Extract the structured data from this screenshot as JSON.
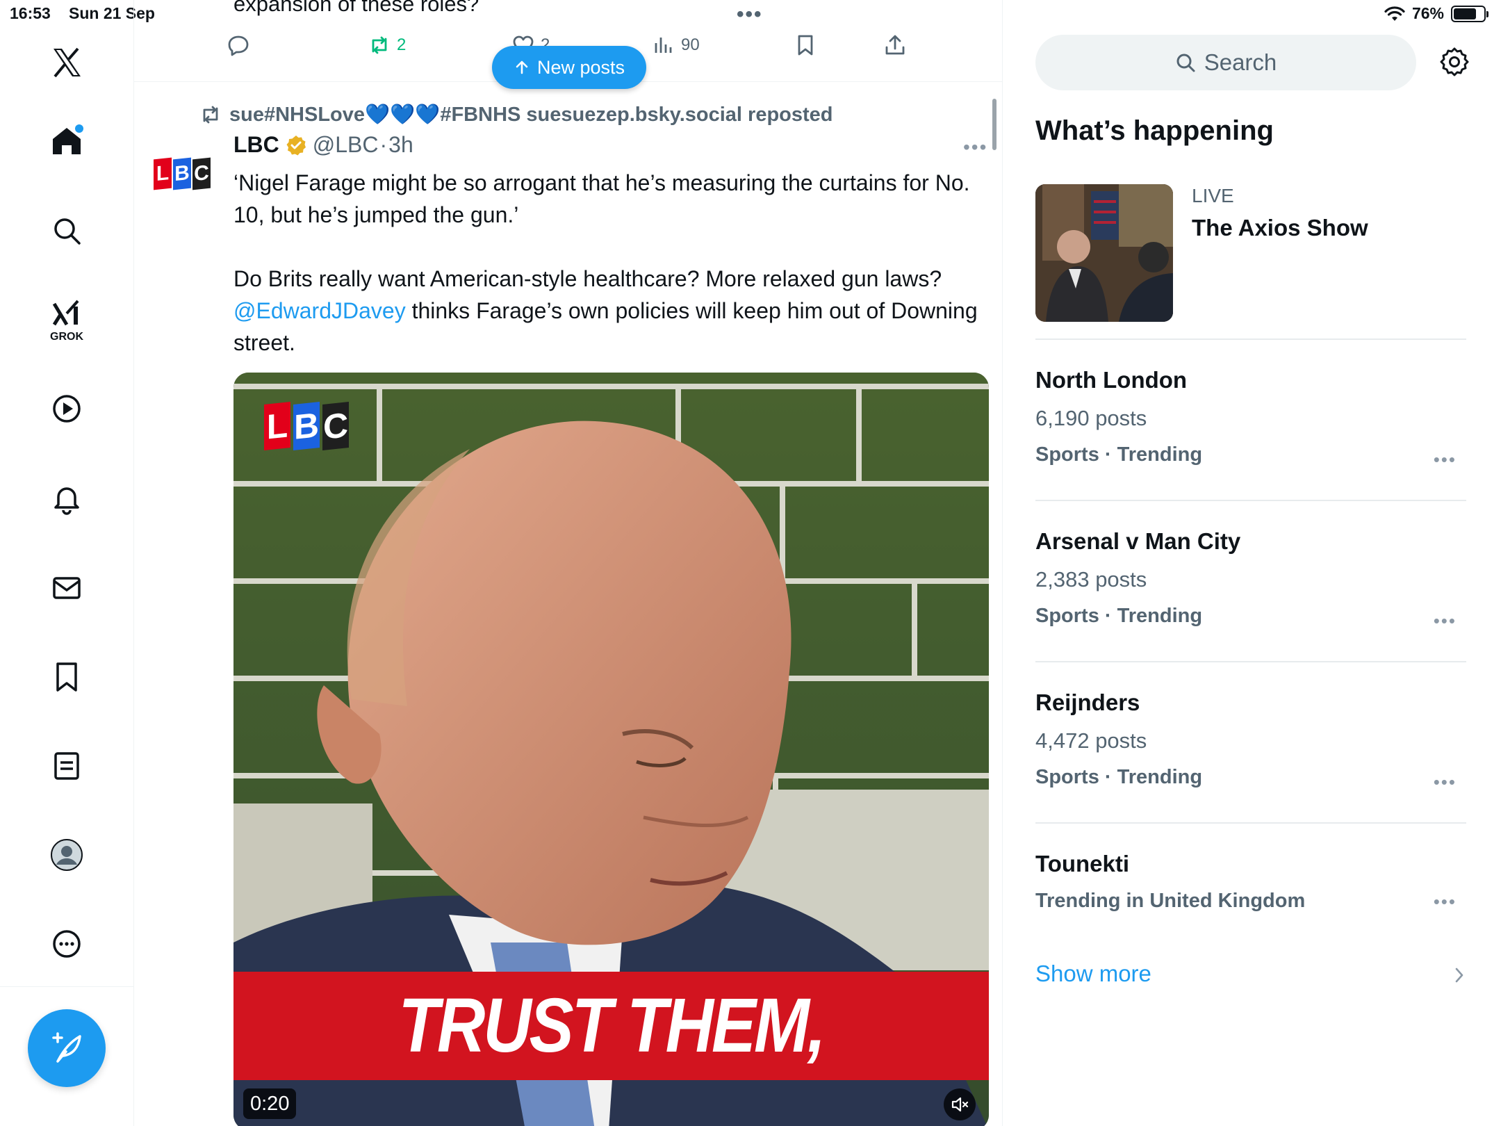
{
  "status_bar": {
    "time": "16:53",
    "date": "Sun 21 Sep",
    "battery": "76%",
    "battery_level": 0.76
  },
  "nav": {
    "logo": "x-logo-icon",
    "items": [
      "home-icon",
      "explore-icon",
      "grok-icon",
      "video-icon",
      "notifications-icon",
      "messages-icon",
      "bookmarks-icon",
      "lists-icon",
      "profile-icon",
      "more-icon"
    ],
    "grok_label": "GROK",
    "compose": "compose-post-icon"
  },
  "timeline": {
    "previous_post_text": "expansion of these roles?",
    "previous_actions": {
      "reposts": "2",
      "likes": "2",
      "views": "90"
    },
    "new_posts_label": "New posts",
    "repost_by": "sue#NHSLove",
    "repost_hearts": "💙💙💙",
    "repost_suffix": "#FBNHS suesuezep.bsky.social reposted",
    "post": {
      "author": "LBC",
      "handle": "@LBC",
      "dot": "·",
      "time": "3h",
      "text_line1": "‘Nigel Farage might be so arrogant that he’s measuring the curtains for No. 10, but he’s jumped the gun.’",
      "text_line2_before": "Do Brits really want American-style healthcare? More relaxed gun laws?",
      "mention": "@EdwardJDavey",
      "text_line2_after": " thinks Farage’s own policies will keep him out of Downing street.",
      "media": {
        "logo_letters": [
          "L",
          "B",
          "C"
        ],
        "caption": "TRUST THEM,",
        "duration": "0:20"
      }
    }
  },
  "sidebar": {
    "search_placeholder": "Search",
    "section_title": "What’s happening",
    "live": {
      "label": "LIVE",
      "title": "The Axios Show"
    },
    "trends": [
      {
        "name": "North London",
        "count": "6,190 posts",
        "category": "Sports · Trending"
      },
      {
        "name": "Arsenal v Man City",
        "count": "2,383 posts",
        "category": "Sports · Trending"
      },
      {
        "name": "Reijnders",
        "count": "4,472 posts",
        "category": "Sports · Trending"
      },
      {
        "name": "Tounekti",
        "count": "",
        "category": "Trending in United Kingdom"
      }
    ],
    "show_more": "Show more"
  },
  "colors": {
    "accent": "#1d9bf0",
    "repost_green": "#00ba7c",
    "secondary_text": "#536471",
    "lbc_red": "#e2001a",
    "lbc_blue": "#1b62e0",
    "caption_red": "#d2141f"
  }
}
